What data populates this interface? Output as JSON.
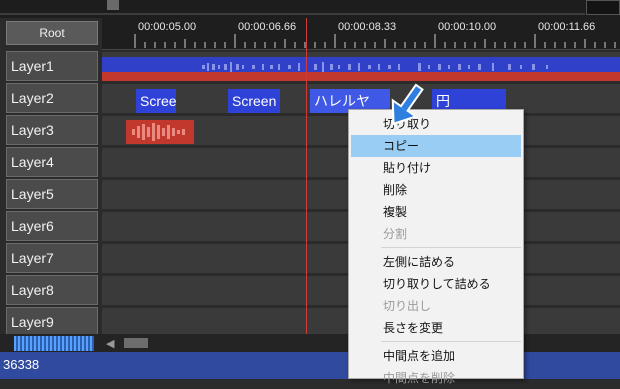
{
  "root_button": "Root",
  "ruler": {
    "labels": [
      "00:00:05.00",
      "00:00:06.66",
      "00:00:08.33",
      "00:00:10.00",
      "00:00:11.66"
    ]
  },
  "layers": [
    "Layer1",
    "Layer2",
    "Layer3",
    "Layer4",
    "Layer5",
    "Layer6",
    "Layer7",
    "Layer8",
    "Layer9"
  ],
  "clips": [
    {
      "label": "Scree"
    },
    {
      "label": "Screen"
    },
    {
      "label": "ハレルヤ"
    },
    {
      "label": "円"
    }
  ],
  "context_menu": {
    "items": [
      {
        "label": "切り取り",
        "enabled": true
      },
      {
        "label": "コピー",
        "enabled": true,
        "highlighted": true
      },
      {
        "label": "貼り付け",
        "enabled": true
      },
      {
        "label": "削除",
        "enabled": true
      },
      {
        "label": "複製",
        "enabled": true
      },
      {
        "label": "分割",
        "enabled": false
      },
      {
        "label": "左側に詰める",
        "enabled": true
      },
      {
        "label": "切り取りして詰める",
        "enabled": true
      },
      {
        "label": "切り出し",
        "enabled": false
      },
      {
        "label": "長さを変更",
        "enabled": true
      },
      {
        "label": "中間点を追加",
        "enabled": true
      },
      {
        "label": "中間点を削除",
        "enabled": false
      }
    ]
  },
  "status_bar": {
    "text": "36338"
  },
  "colors": {
    "clip_blue": "#2f42d8",
    "audio_red": "#c2382d",
    "menu_highlight": "#99cdf4",
    "status_bar": "#2f4a9e",
    "playhead": "#d23a3a"
  }
}
